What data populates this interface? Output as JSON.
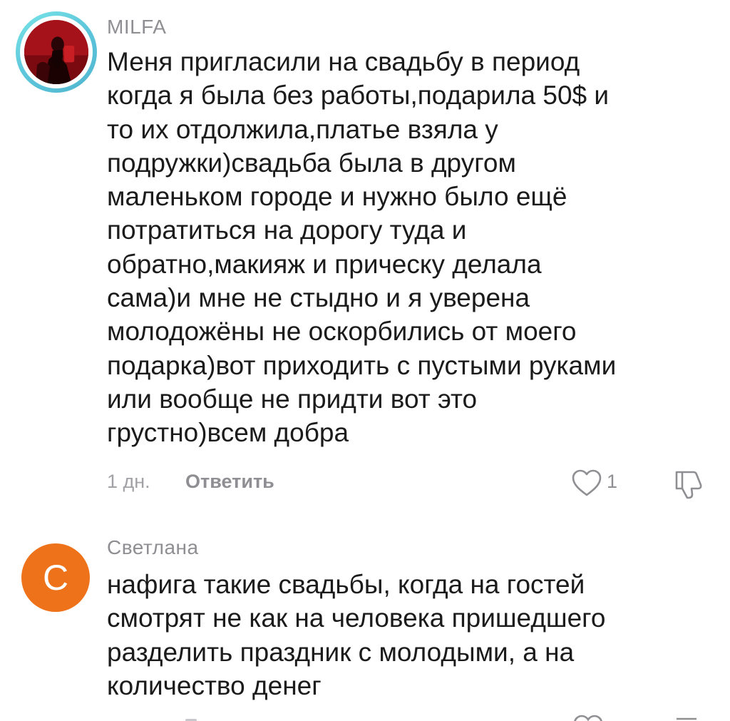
{
  "comments": [
    {
      "author": "MILFA",
      "avatar": {
        "type": "photo",
        "ring_color": "#5fc8dc",
        "bg_color": "#b3141a"
      },
      "text_lines": [
        "Меня пригласили на свадьбу в период",
        "когда я была без работы,подарила 50$ и",
        "то их отдолжила,платье взяла у",
        "подружки)свадьба была в другом",
        "маленьком городе и нужно было ещё",
        "потратиться на дорогу туда и",
        "обратно,макияж и прическу делала",
        "сама)и мне не стыдно и я уверена",
        "молодожёны не оскорбились от моего",
        "подарка)вот приходить с пустыми руками",
        "или вообще не придти вот это",
        "грустно)всем добра"
      ],
      "time": "1 дн.",
      "reply_label": "Ответить",
      "like_icon": "heart-outline-icon",
      "likes": "1",
      "dislike_icon": "thumbs-down-outline-icon"
    },
    {
      "author": "Светлана",
      "avatar": {
        "type": "letter",
        "letter": "C",
        "bg_color": "#ee7219"
      },
      "text_lines": [
        "нафига такие свадьбы, когда на гостей",
        "смотрят не как на человека пришедшего",
        "разделить праздник с молодыми, а на",
        "количество денег"
      ]
    }
  ]
}
